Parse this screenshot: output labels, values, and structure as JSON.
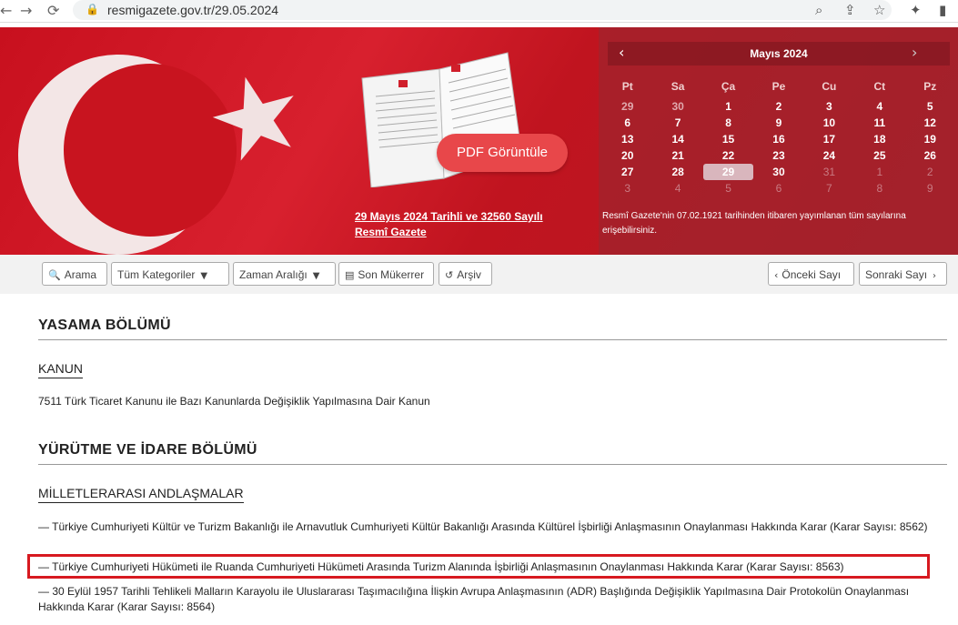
{
  "browser": {
    "url": "resmigazete.gov.tr/29.05.2024",
    "back_icon": "←",
    "forward_icon": "→",
    "reload_icon": "⟳"
  },
  "banner": {
    "pdf_button": "PDF Görüntüle",
    "issue_link": "29 Mayıs 2024 Tarihli ve 32560 Sayılı Resmî Gazete",
    "archive_note": "Resmî Gazete'nin 07.02.1921 tarihinden itibaren yayımlanan tüm sayılarına erişebilirsiniz."
  },
  "calendar": {
    "month_label": "Mayıs 2024",
    "weekdays": [
      "Pt",
      "Sa",
      "Ça",
      "Pe",
      "Cu",
      "Ct",
      "Pz"
    ],
    "weeks": [
      [
        "29",
        "30",
        "1",
        "2",
        "3",
        "4",
        "5"
      ],
      [
        "6",
        "7",
        "8",
        "9",
        "10",
        "11",
        "12"
      ],
      [
        "13",
        "14",
        "15",
        "16",
        "17",
        "18",
        "19"
      ],
      [
        "20",
        "21",
        "22",
        "23",
        "24",
        "25",
        "26"
      ],
      [
        "27",
        "28",
        "29",
        "30",
        "31",
        "1",
        "2"
      ],
      [
        "3",
        "4",
        "5",
        "6",
        "7",
        "8",
        "9"
      ]
    ],
    "selected": "29"
  },
  "toolbar": {
    "search": "Arama",
    "categories": "Tüm Kategoriler",
    "time_range": "Zaman Aralığı",
    "last_repeat": "Son Mükerrer",
    "archive": "Arşiv",
    "prev_issue": "Önceki Sayı",
    "next_issue": "Sonraki Sayı"
  },
  "content": {
    "section1_title": "YASAMA BÖLÜMÜ",
    "section1_sub": "KANUN",
    "section1_item": "7511 Türk Ticaret Kanunu ile Bazı Kanunlarda Değişiklik Yapılmasına Dair Kanun",
    "section2_title": "YÜRÜTME VE İDARE BÖLÜMÜ",
    "section2_sub": "MİLLETLERARASI ANDLAŞMALAR",
    "items": [
      "— Türkiye Cumhuriyeti Kültür ve Turizm Bakanlığı ile Arnavutluk Cumhuriyeti Kültür Bakanlığı Arasında Kültürel İşbirliği Anlaşmasının Onaylanması Hakkında Karar (Karar Sayısı: 8562)",
      "— Türkiye Cumhuriyeti Hükümeti ile Ruanda Cumhuriyeti Hükümeti Arasında Turizm Alanında İşbirliği Anlaşmasının Onaylanması Hakkında Karar (Karar Sayısı: 8563)",
      "— 30 Eylül 1957 Tarihli Tehlikeli Malların Karayolu ile Uluslararası Taşımacılığına İlişkin Avrupa Anlaşmasının (ADR) Başlığında Değişiklik Yapılmasına Dair Protokolün Onaylanması Hakkında Karar (Karar Sayısı: 8564)"
    ]
  },
  "colors": {
    "banner_red": "#c8101e",
    "highlight": "#d71920",
    "pdf_button": "#e8474a"
  }
}
